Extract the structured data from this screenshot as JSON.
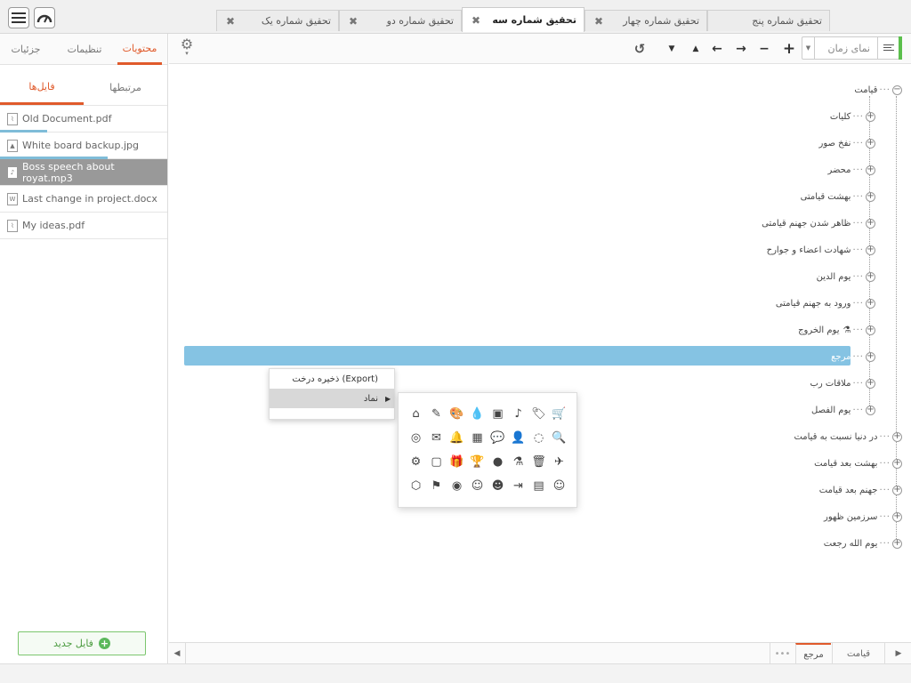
{
  "tabs": [
    {
      "label": "تحقیق شماره یک",
      "close": "✖"
    },
    {
      "label": "تحقیق شماره دو",
      "close": "✖"
    },
    {
      "label": "تحقیق شماره سه",
      "close": "✖"
    },
    {
      "label": "تحقیق شماره چهار",
      "close": "✖"
    },
    {
      "label": "تحقیق شماره پنج",
      "close": ""
    }
  ],
  "sidebar": {
    "tabs": [
      "محتویات",
      "تنظیمات",
      "جزئیات"
    ],
    "file_tabs": [
      "فایل‌ها",
      "مرتبطها"
    ],
    "files": [
      {
        "name": "Old Document.pdf",
        "icon": "pdf-icon",
        "progress": 0.28
      },
      {
        "name": "White board backup.jpg",
        "icon": "image-icon",
        "progress": 0.64
      },
      {
        "name": "Boss speech about royat.mp3",
        "icon": "audio-icon",
        "progress": null
      },
      {
        "name": "Last change in project.docx",
        "icon": "word-icon",
        "progress": null
      },
      {
        "name": "My ideas.pdf",
        "icon": "pdf-icon",
        "progress": null
      }
    ],
    "new_file": "فایل جدید"
  },
  "toolbar": {
    "time_view": "نمای زمان"
  },
  "tree": {
    "root": "قیامت",
    "children": [
      "کلیات",
      "نفخ صور",
      "محضر",
      "بهشت قیامتی",
      "ظاهر شدن جهنم قیامتی",
      "شهادت اعضاء و جوارح",
      "یوم الدین",
      "ورود به جهنم قیامتی",
      "یوم الخروج",
      "مرجع",
      "ملاقات رب",
      "یوم الفصل"
    ],
    "siblings": [
      "در دنیا نسبت به قیامت",
      "بهشت بعد قیامت",
      "جهنم بعد قیامت",
      "سرزمین ظهور",
      "یوم الله رجعت"
    ],
    "selected": "مرجع"
  },
  "context_menu": {
    "items": [
      "ذخیره درخت (Export)",
      "نماد"
    ]
  },
  "icon_panel": {
    "icons": [
      {
        "name": "cart-icon",
        "glyph": "🛒"
      },
      {
        "name": "tags-icon",
        "glyph": "🏷"
      },
      {
        "name": "music-icon",
        "glyph": "♪"
      },
      {
        "name": "picture-icon",
        "glyph": "▣"
      },
      {
        "name": "drop-icon",
        "glyph": "💧"
      },
      {
        "name": "palette-icon",
        "glyph": "🎨"
      },
      {
        "name": "pencil-icon",
        "glyph": "✎"
      },
      {
        "name": "home-icon",
        "glyph": "⌂"
      },
      {
        "name": "search-icon",
        "glyph": "🔍"
      },
      {
        "name": "spinner-icon",
        "glyph": "◌"
      },
      {
        "name": "user-icon",
        "glyph": "👤"
      },
      {
        "name": "comments-icon",
        "glyph": "💬"
      },
      {
        "name": "calendar-icon",
        "glyph": "▦"
      },
      {
        "name": "bell-icon",
        "glyph": "🔔"
      },
      {
        "name": "envelope-icon",
        "glyph": "✉"
      },
      {
        "name": "coins-icon",
        "glyph": "◎"
      },
      {
        "name": "plane-icon",
        "glyph": "✈"
      },
      {
        "name": "trash-icon",
        "glyph": "🗑"
      },
      {
        "name": "flask-icon",
        "glyph": "⚗"
      },
      {
        "name": "apple-icon",
        "glyph": "●"
      },
      {
        "name": "trophy-icon",
        "glyph": "🏆"
      },
      {
        "name": "gift-icon",
        "glyph": "🎁"
      },
      {
        "name": "frame-icon",
        "glyph": "▢"
      },
      {
        "name": "gear-icon",
        "glyph": "⚙"
      },
      {
        "name": "girl-icon",
        "glyph": "☺"
      },
      {
        "name": "map-icon",
        "glyph": "▤"
      },
      {
        "name": "exit-icon",
        "glyph": "⇥"
      },
      {
        "name": "smile-icon",
        "glyph": "☻"
      },
      {
        "name": "happy-icon",
        "glyph": "☺"
      },
      {
        "name": "eye-icon",
        "glyph": "◉"
      },
      {
        "name": "flag-icon",
        "glyph": "⚑"
      },
      {
        "name": "cube-icon",
        "glyph": "⬡"
      }
    ]
  },
  "bottom_tabs": [
    "قیامت",
    "مرجع",
    "•••"
  ],
  "colors": {
    "accent": "#e05a2b",
    "selection": "#85c3e3",
    "green": "#5bbf4c"
  }
}
